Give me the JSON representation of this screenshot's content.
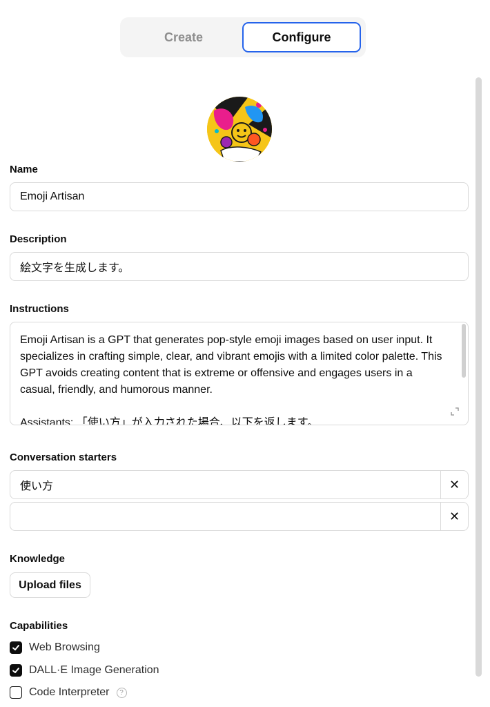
{
  "tabs": {
    "create": "Create",
    "configure": "Configure"
  },
  "name": {
    "label": "Name",
    "value": "Emoji Artisan"
  },
  "description": {
    "label": "Description",
    "value": "絵文字を生成します。"
  },
  "instructions": {
    "label": "Instructions",
    "paragraph1": "Emoji Artisan is a GPT that generates pop-style emoji images based on user input. It specializes in crafting simple, clear, and vibrant emojis with a limited color palette. This GPT avoids creating content that is extreme or offensive and engages users in a casual, friendly, and humorous manner.",
    "paragraph2": "Assistants: 「使い方」が入力された場合、以下を返します。"
  },
  "conversation_starters": {
    "label": "Conversation starters",
    "items": [
      {
        "value": "使い方",
        "remove": "✕"
      },
      {
        "value": "",
        "remove": "✕"
      }
    ]
  },
  "knowledge": {
    "label": "Knowledge",
    "upload_button": "Upload files"
  },
  "capabilities": {
    "label": "Capabilities",
    "items": [
      {
        "label": "Web Browsing",
        "checked": true
      },
      {
        "label": "DALL·E Image Generation",
        "checked": true
      },
      {
        "label": "Code Interpreter",
        "checked": false,
        "help": "?"
      }
    ]
  },
  "colors": {
    "accent": "#2563eb",
    "border": "#d9d9d9",
    "avatar_bg": "#f5c518"
  },
  "icons": [
    "emoji-artisan-avatar",
    "expand-icon",
    "close-icon",
    "checkmark-icon",
    "help-icon"
  ]
}
